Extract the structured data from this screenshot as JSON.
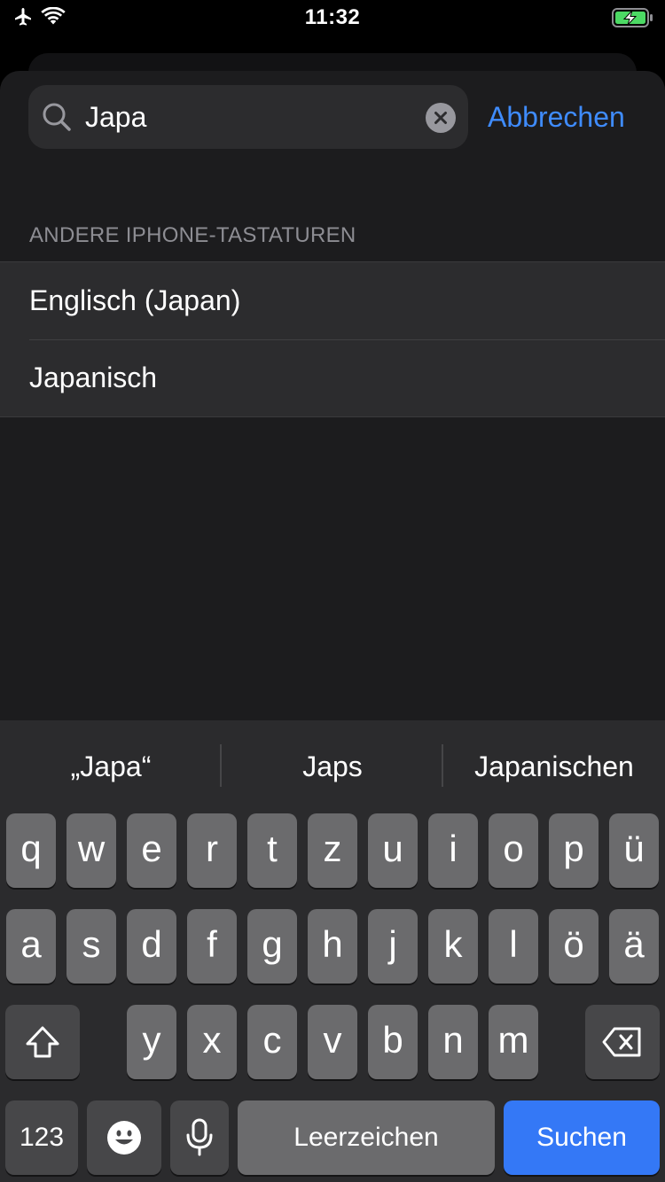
{
  "status_bar": {
    "time": "11:32"
  },
  "search": {
    "value": "Japa",
    "cancel_label": "Abbrechen"
  },
  "section": {
    "header": "ANDERE IPHONE-TASTATUREN"
  },
  "results": [
    {
      "label": "Englisch (Japan)"
    },
    {
      "label": "Japanisch"
    }
  ],
  "keyboard": {
    "suggestions": [
      "„Japa“",
      "Japs",
      "Japanischen"
    ],
    "row1": [
      "q",
      "w",
      "e",
      "r",
      "t",
      "z",
      "u",
      "i",
      "o",
      "p",
      "ü"
    ],
    "row2": [
      "a",
      "s",
      "d",
      "f",
      "g",
      "h",
      "j",
      "k",
      "l",
      "ö",
      "ä"
    ],
    "row3": [
      "y",
      "x",
      "c",
      "v",
      "b",
      "n",
      "m"
    ],
    "numbers_label": "123",
    "space_label": "Leerzeichen",
    "return_label": "Suchen",
    "icons": {
      "shift": "shift-icon",
      "backspace": "backspace-icon",
      "emoji": "emoji-icon",
      "dictation": "microphone-icon"
    }
  },
  "colors": {
    "accent": "#3f8cff",
    "return_key": "#3478f6",
    "battery_charging": "#4cd964"
  }
}
